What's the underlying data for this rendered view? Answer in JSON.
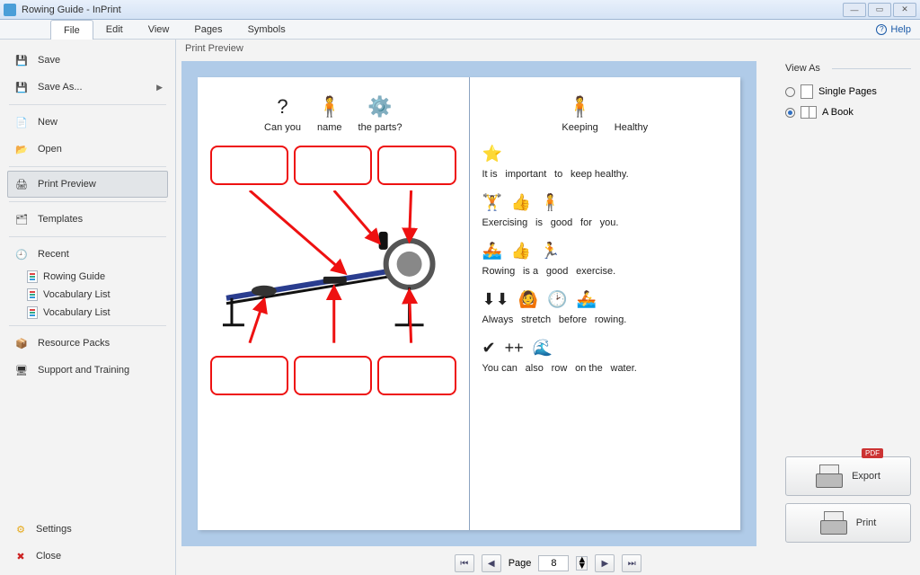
{
  "window": {
    "title": "Rowing Guide - InPrint"
  },
  "menubar": {
    "file": "File",
    "edit": "Edit",
    "view": "View",
    "pages": "Pages",
    "symbols": "Symbols",
    "help": "Help"
  },
  "sidebar": {
    "save": "Save",
    "save_as": "Save As...",
    "new": "New",
    "open": "Open",
    "print_preview": "Print Preview",
    "templates": "Templates",
    "recent": "Recent",
    "recent_items": [
      "Rowing Guide",
      "Vocabulary List",
      "Vocabulary List"
    ],
    "resource_packs": "Resource Packs",
    "support": "Support and Training",
    "settings": "Settings",
    "close": "Close"
  },
  "preview": {
    "label": "Print Preview",
    "left_head": [
      "Can you",
      "name",
      "the parts?"
    ],
    "right_head": [
      "Keeping",
      "Healthy"
    ],
    "sent1": [
      "It is",
      "important",
      "to",
      "keep healthy."
    ],
    "sent2": [
      "Exercising",
      "is",
      "good",
      "for",
      "you."
    ],
    "sent3": [
      "Rowing",
      "is a",
      "good",
      "exercise."
    ],
    "sent4": [
      "Always",
      "stretch",
      "before",
      "rowing."
    ],
    "sent5": [
      "You can",
      "also",
      "row",
      "on the",
      "water."
    ]
  },
  "pager": {
    "label": "Page",
    "value": "8"
  },
  "view_as": {
    "title": "View As",
    "single": "Single Pages",
    "book": "A Book",
    "selected": "book"
  },
  "buttons": {
    "export": "Export",
    "export_badge": "PDF",
    "print": "Print"
  }
}
